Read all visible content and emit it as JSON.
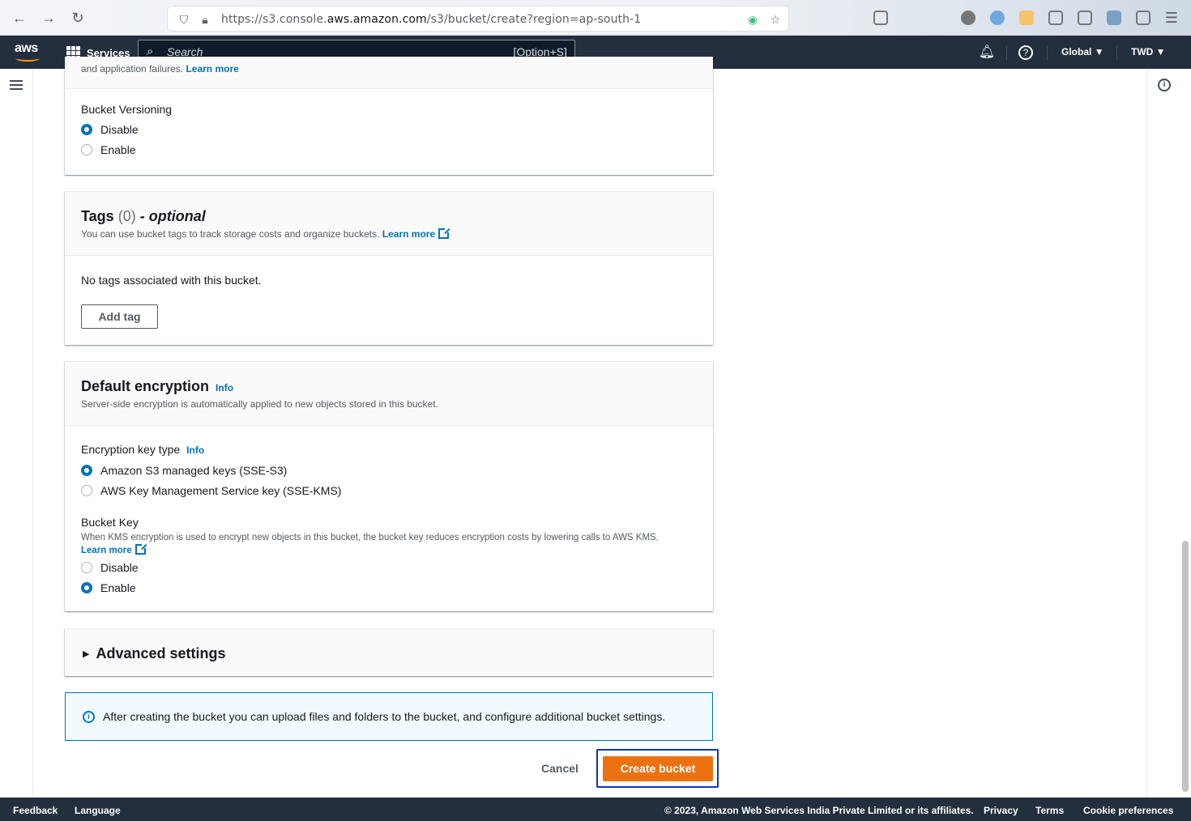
{
  "browser": {
    "url_prefix": "https://s3.console.",
    "url_host": "aws.amazon.com",
    "url_path": "/s3/bucket/create?region=ap-south-1"
  },
  "header": {
    "logo": "aws",
    "services_label": "Services",
    "search_placeholder": "Search",
    "search_shortcut": "[Option+S]",
    "region_label": "Global",
    "account_label": "TWD"
  },
  "versioning": {
    "top_text": "and application failures.",
    "top_link": "Learn more",
    "label": "Bucket Versioning",
    "options": [
      "Disable",
      "Enable"
    ],
    "selected": "Disable"
  },
  "tags": {
    "title": "Tags",
    "count": "(0)",
    "optional": "- optional",
    "description": "You can use bucket tags to track storage costs and organize buckets.",
    "learn_more": "Learn more",
    "empty_text": "No tags associated with this bucket.",
    "add_button": "Add tag"
  },
  "encryption": {
    "title": "Default encryption",
    "info": "Info",
    "description": "Server-side encryption is automatically applied to new objects stored in this bucket.",
    "key_type_label": "Encryption key type",
    "key_type_info": "Info",
    "key_options": [
      "Amazon S3 managed keys (SSE-S3)",
      "AWS Key Management Service key (SSE-KMS)"
    ],
    "key_selected": "Amazon S3 managed keys (SSE-S3)",
    "bucket_key_label": "Bucket Key",
    "bucket_key_desc": "When KMS encryption is used to encrypt new objects in this bucket, the bucket key reduces encryption costs by lowering calls to AWS KMS.",
    "bucket_key_learn_more": "Learn more",
    "bucket_key_options": [
      "Disable",
      "Enable"
    ],
    "bucket_key_selected": "Enable"
  },
  "advanced": {
    "title": "Advanced settings"
  },
  "flash": {
    "message": "After creating the bucket you can upload files and folders to the bucket, and configure additional bucket settings."
  },
  "actions": {
    "cancel": "Cancel",
    "create": "Create bucket"
  },
  "footer": {
    "feedback": "Feedback",
    "language": "Language",
    "copyright": "© 2023, Amazon Web Services India Private Limited or its affiliates.",
    "privacy": "Privacy",
    "terms": "Terms",
    "cookies": "Cookie preferences"
  },
  "colors": {
    "header_bg": "#232f3e",
    "link": "#0073bb",
    "primary_button": "#ec7211",
    "focus_ring": "#0a36c9"
  }
}
